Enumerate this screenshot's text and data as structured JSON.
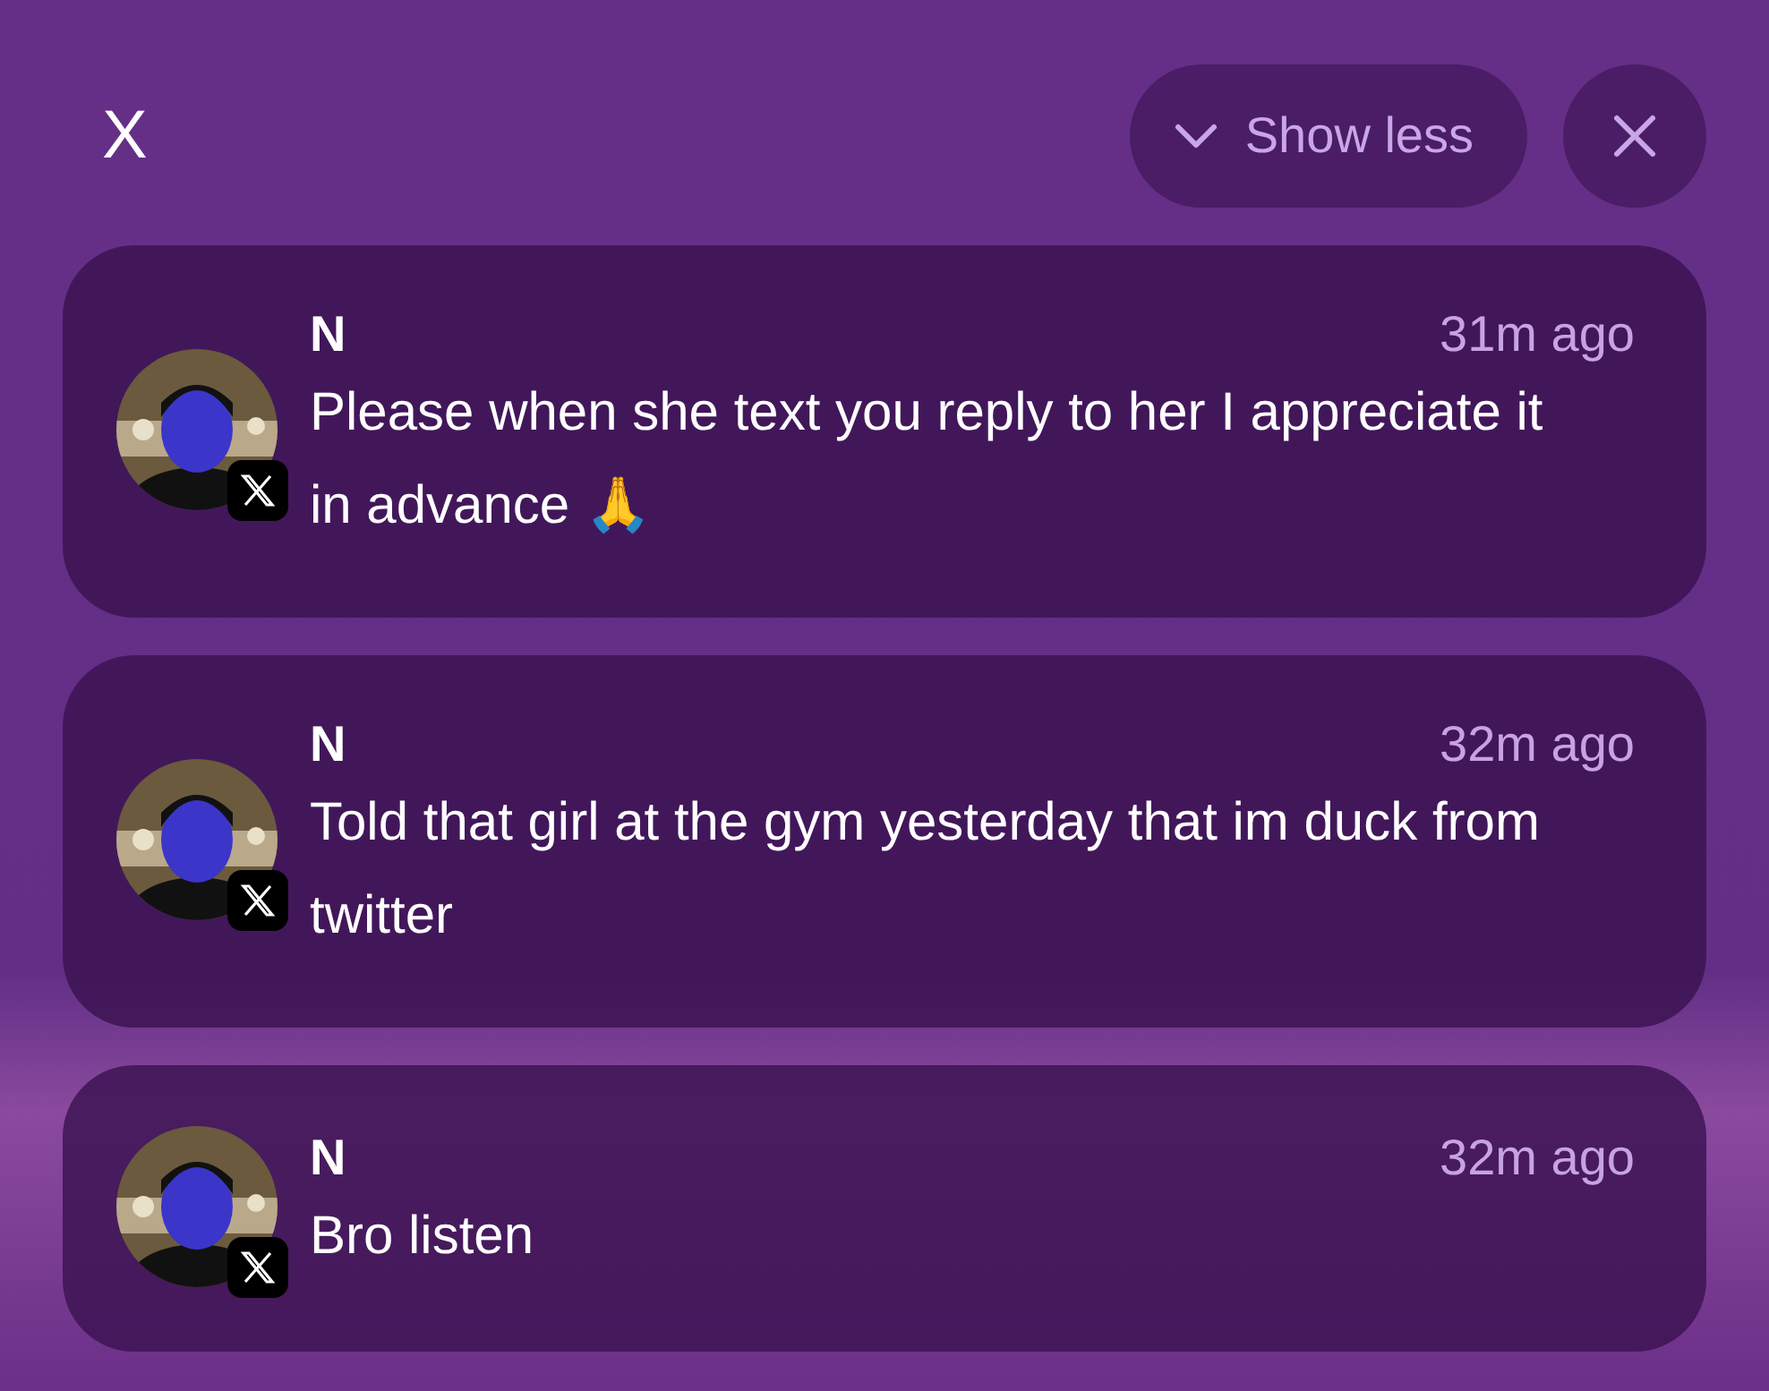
{
  "app_title": "X",
  "controls": {
    "show_less": {
      "label": "Show less",
      "expanded": true
    }
  },
  "notifications": [
    {
      "sender": "N",
      "time": "31m ago",
      "message": "Please when she text you reply to her I appreciate it in advance 🙏"
    },
    {
      "sender": "N",
      "time": "32m ago",
      "message": "Told that girl at the gym yesterday that im duck from twitter"
    },
    {
      "sender": "N",
      "time": "32m ago",
      "message": "Bro listen"
    }
  ]
}
